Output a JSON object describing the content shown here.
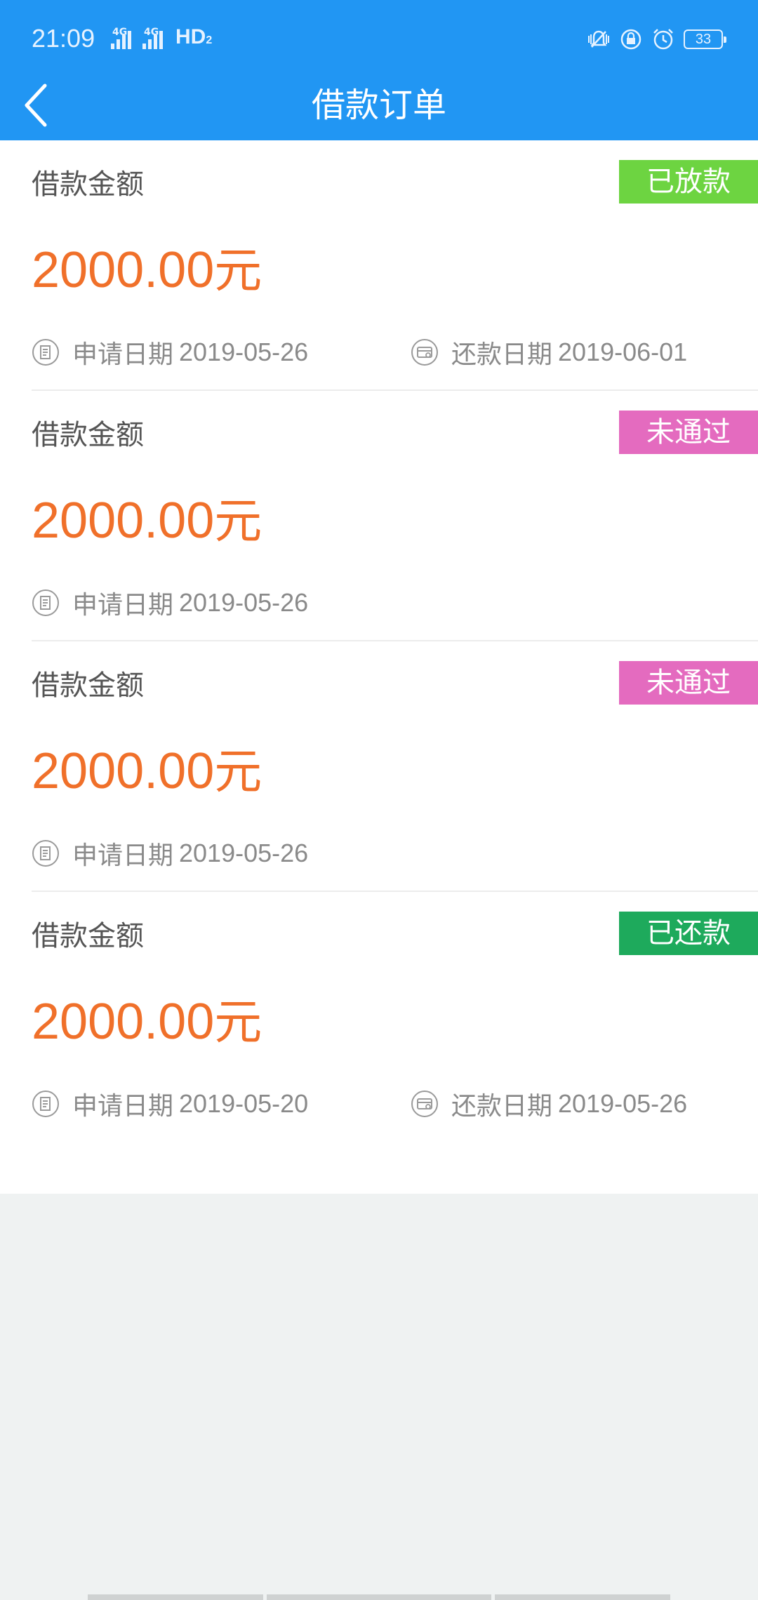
{
  "status_bar": {
    "time": "21:09",
    "network_1": "4G",
    "network_2": "4G",
    "hd_label": "HD",
    "hd_sub": "2",
    "battery_level": "33"
  },
  "header": {
    "title": "借款订单",
    "back_icon": "chevron-left-icon"
  },
  "labels": {
    "amount_label": "借款金额",
    "apply_date_label": "申请日期",
    "repay_date_label": "还款日期"
  },
  "colors": {
    "header_bg": "#2196f3",
    "amount": "#f0702a",
    "status_disbursed": "#6dd441",
    "status_rejected": "#e46bbf",
    "status_repaid": "#1eaa5c"
  },
  "orders": [
    {
      "status": "已放款",
      "status_color": "#6dd441",
      "amount": "2000.00",
      "unit": "元",
      "apply_date": "2019-05-26",
      "repay_date": "2019-06-01"
    },
    {
      "status": "未通过",
      "status_color": "#e46bbf",
      "amount": "2000.00",
      "unit": "元",
      "apply_date": "2019-05-26"
    },
    {
      "status": "未通过",
      "status_color": "#e46bbf",
      "amount": "2000.00",
      "unit": "元",
      "apply_date": "2019-05-26"
    },
    {
      "status": "已还款",
      "status_color": "#1eaa5c",
      "amount": "2000.00",
      "unit": "元",
      "apply_date": "2019-05-20",
      "repay_date": "2019-05-26"
    }
  ]
}
